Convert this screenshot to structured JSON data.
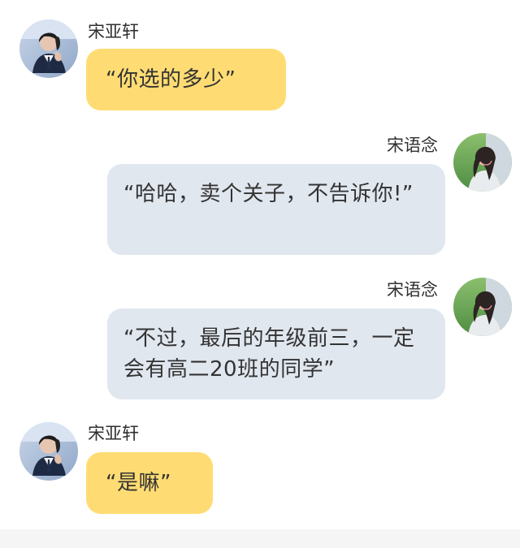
{
  "messages": [
    {
      "sender": "宋亚轩",
      "side": "left",
      "text": "“你选的多少”"
    },
    {
      "sender": "宋语念",
      "side": "right",
      "text": "“哈哈，卖个关子，不告诉你!”"
    },
    {
      "sender": "宋语念",
      "side": "right",
      "text": "“不过，最后的年级前三，一定会有高二20班的同学”"
    },
    {
      "sender": "宋亚轩",
      "side": "left",
      "text": "“是嘛”"
    }
  ],
  "colors": {
    "left_bubble": "#ffdc73",
    "right_bubble": "#e1e7ef",
    "text": "#333333",
    "bottom_bar": "#f5f5f5"
  }
}
